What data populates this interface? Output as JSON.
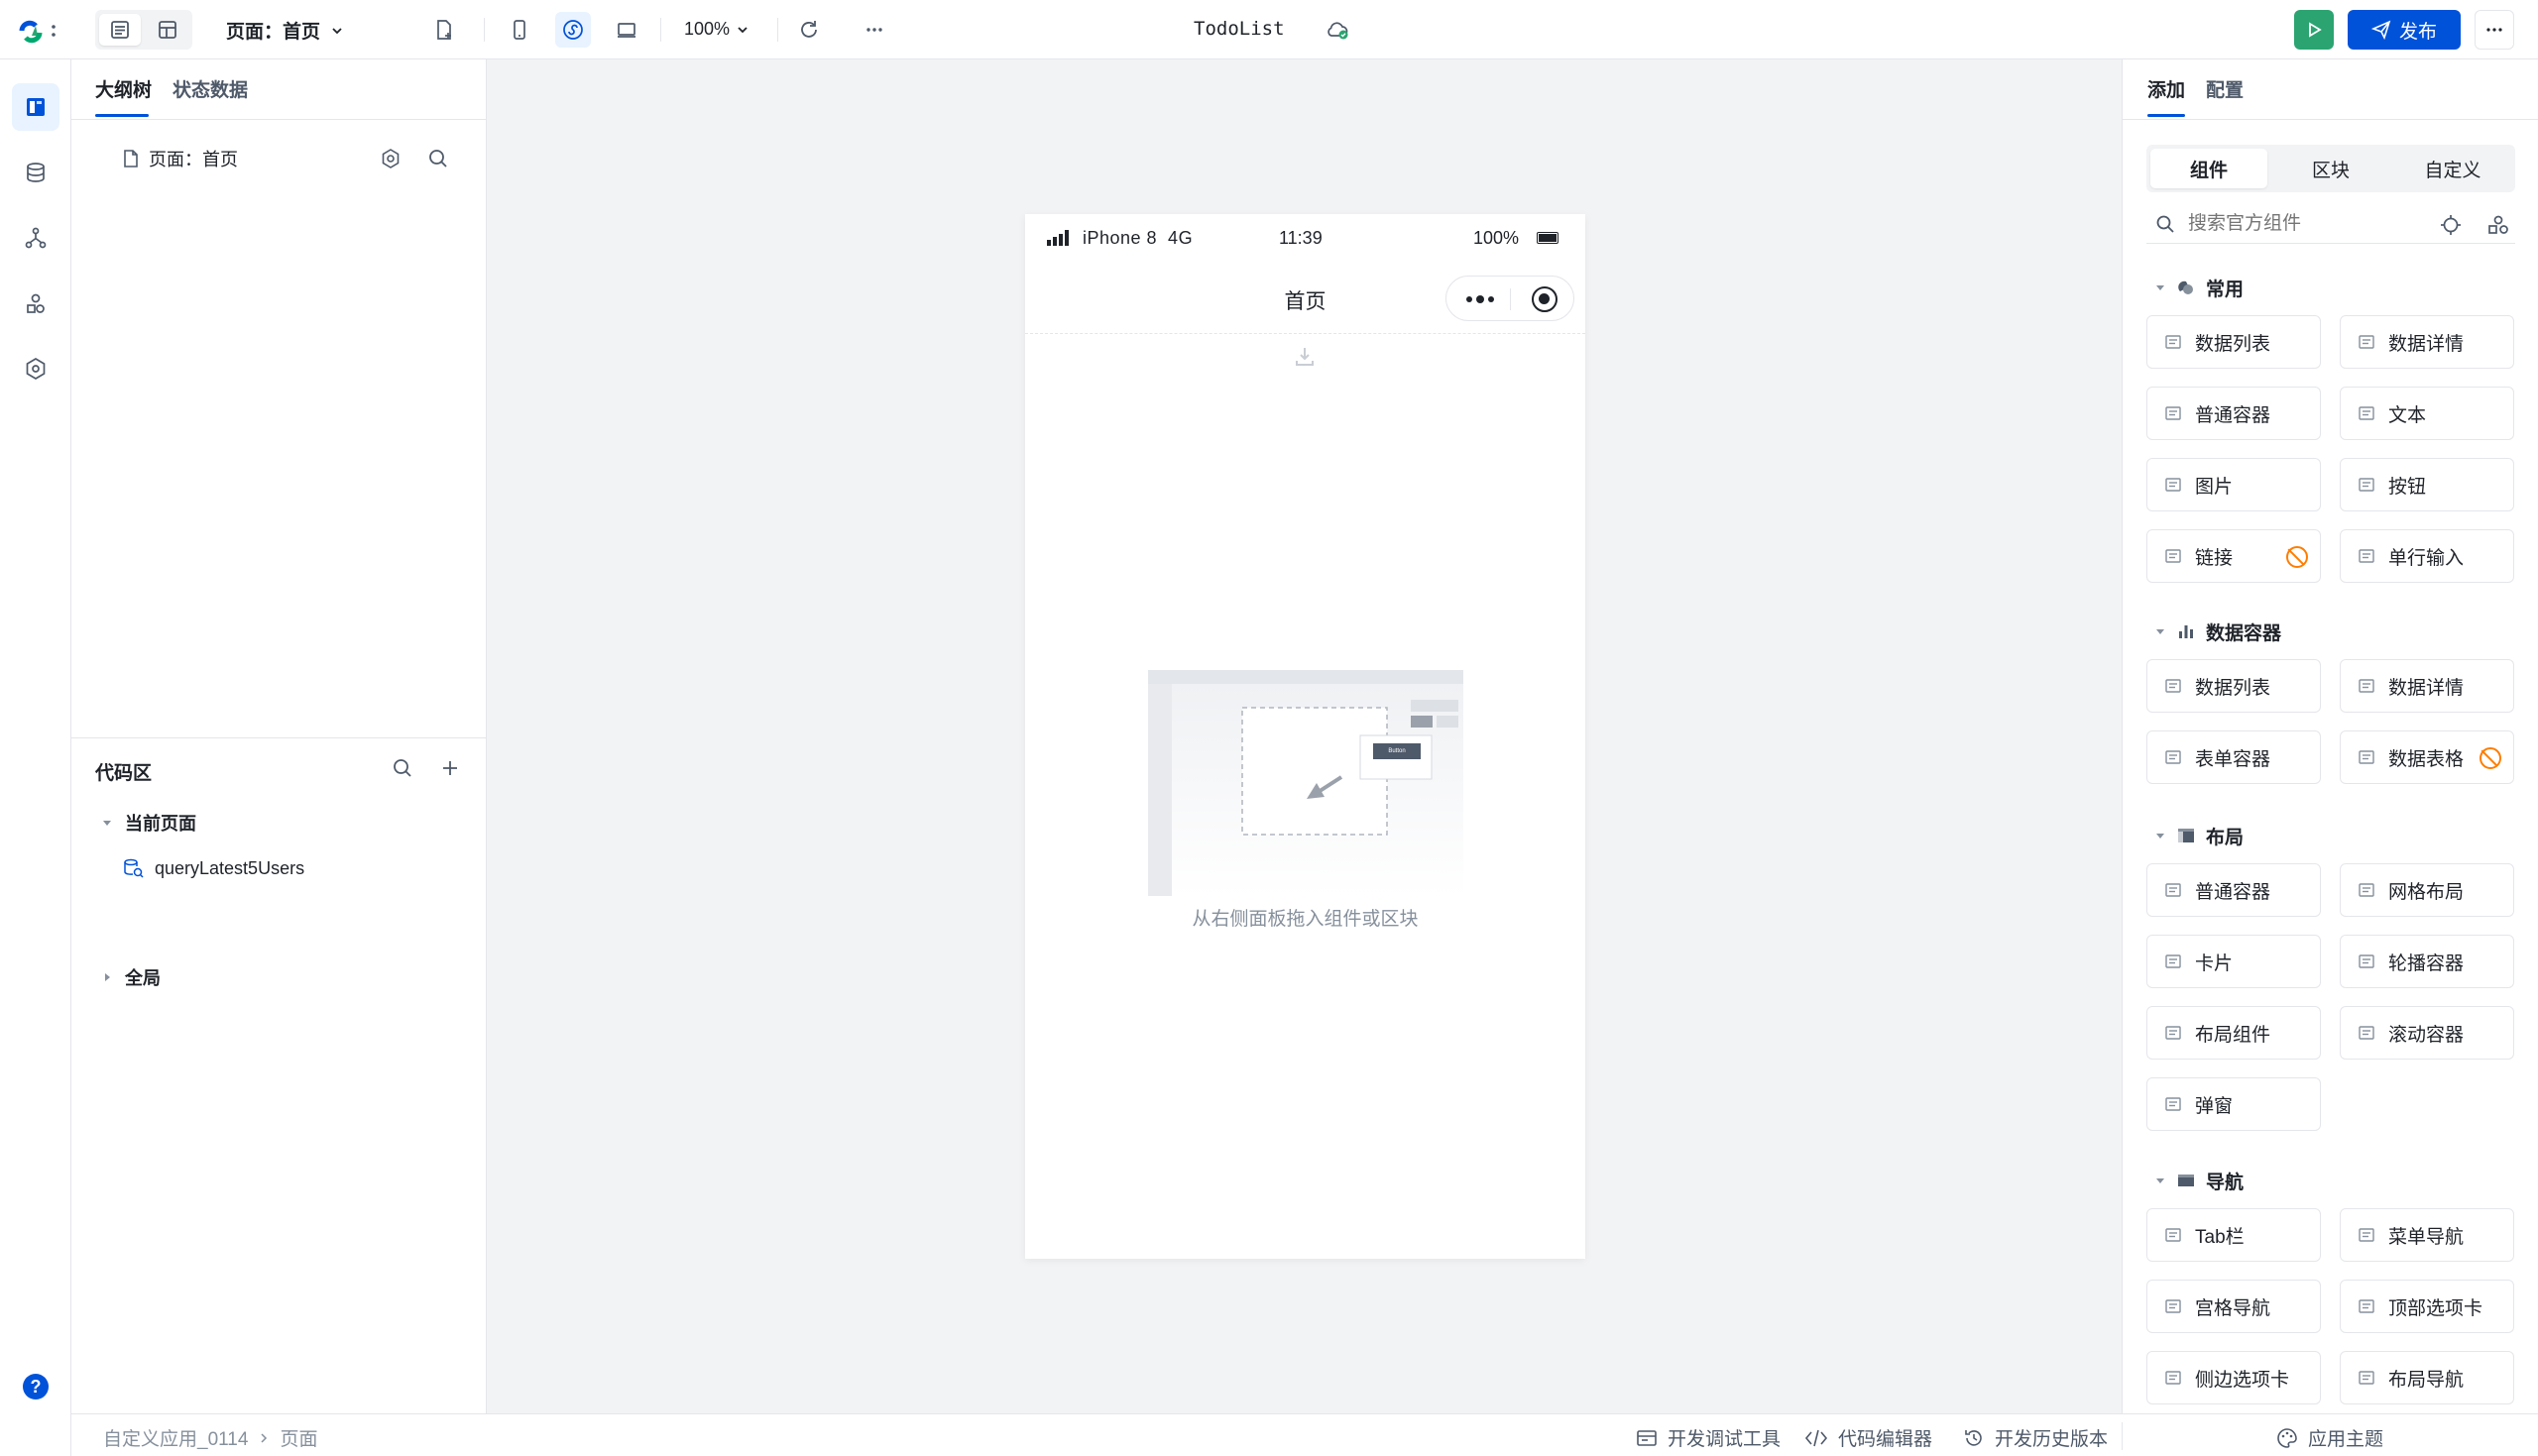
{
  "topbar": {
    "page_selector": "页面：首页",
    "zoom": "100%",
    "app_title": "TodoList",
    "publish_label": "发布"
  },
  "left_panel": {
    "tabs": [
      "大纲树",
      "状态数据"
    ],
    "page_node": "页面：首页",
    "code_area": {
      "title": "代码区",
      "groups": [
        {
          "label": "当前页面",
          "expanded": true,
          "items": [
            "queryLatest5Users"
          ]
        },
        {
          "label": "全局",
          "expanded": false,
          "items": []
        }
      ]
    }
  },
  "phone": {
    "status": {
      "carrier": "iPhone 8  4G",
      "time": "11:39",
      "battery": "100%"
    },
    "nav_title": "首页",
    "placeholder_button": "Button",
    "empty_hint": "从右侧面板拖入组件或区块"
  },
  "right_panel": {
    "tabs": [
      "添加",
      "配置"
    ],
    "segments": [
      "组件",
      "区块",
      "自定义"
    ],
    "search_placeholder": "搜索官方组件",
    "categories": [
      {
        "name": "常用",
        "icon": "common-icon",
        "items": [
          {
            "label": "数据列表",
            "icon": "list-icon"
          },
          {
            "label": "数据详情",
            "icon": "detail-icon"
          },
          {
            "label": "普通容器",
            "icon": "container-icon"
          },
          {
            "label": "文本",
            "icon": "text-icon"
          },
          {
            "label": "图片",
            "icon": "image-icon"
          },
          {
            "label": "按钮",
            "icon": "button-icon"
          },
          {
            "label": "链接",
            "icon": "link-icon",
            "badge": true
          },
          {
            "label": "单行输入",
            "icon": "input-icon"
          }
        ]
      },
      {
        "name": "数据容器",
        "icon": "bar-chart-icon",
        "items": [
          {
            "label": "数据列表",
            "icon": "list-icon"
          },
          {
            "label": "数据详情",
            "icon": "detail-icon"
          },
          {
            "label": "表单容器",
            "icon": "form-icon"
          },
          {
            "label": "数据表格",
            "icon": "table-icon",
            "badge": true
          }
        ]
      },
      {
        "name": "布局",
        "icon": "layout-icon",
        "items": [
          {
            "label": "普通容器",
            "icon": "container-icon"
          },
          {
            "label": "网格布局",
            "icon": "grid-icon"
          },
          {
            "label": "卡片",
            "icon": "card-icon"
          },
          {
            "label": "轮播容器",
            "icon": "carousel-icon"
          },
          {
            "label": "布局组件",
            "icon": "layout-icon"
          },
          {
            "label": "滚动容器",
            "icon": "scroll-icon"
          },
          {
            "label": "弹窗",
            "icon": "modal-icon"
          }
        ]
      },
      {
        "name": "导航",
        "icon": "nav-icon",
        "items": [
          {
            "label": "Tab栏",
            "icon": "tabbar-icon"
          },
          {
            "label": "菜单导航",
            "icon": "menu-icon"
          },
          {
            "label": "宫格导航",
            "icon": "grid-nav-icon"
          },
          {
            "label": "顶部选项卡",
            "icon": "top-tabs-icon"
          },
          {
            "label": "侧边选项卡",
            "icon": "side-tabs-icon"
          },
          {
            "label": "布局导航",
            "icon": "layout-nav-icon"
          }
        ]
      }
    ]
  },
  "statusbar": {
    "breadcrumb": [
      "自定义应用_0114",
      "页面"
    ],
    "tools": [
      "开发调试工具",
      "代码编辑器",
      "开发历史版本"
    ],
    "theme": "应用主题"
  },
  "colors": {
    "primary": "#0052d9",
    "run_green": "#2ba471",
    "warning": "#ff7d00"
  }
}
